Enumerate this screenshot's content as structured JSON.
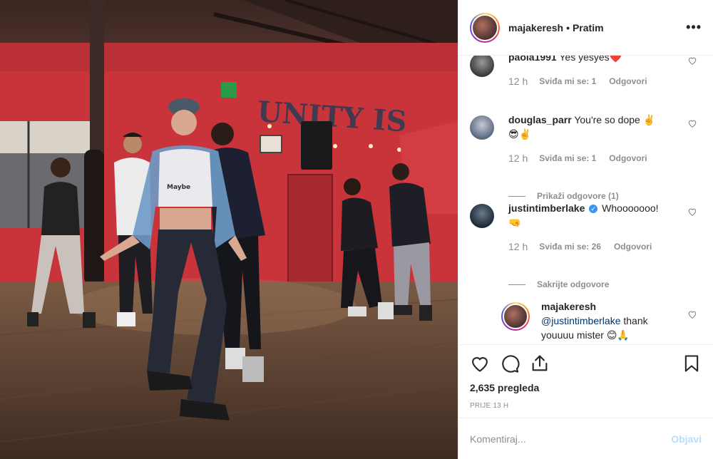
{
  "post": {
    "username": "majakeresh",
    "follow_status": "Pratim",
    "more": "•••",
    "wall_text": "UNITY IS",
    "exit_sign": "EXIT"
  },
  "comments": [
    {
      "user": "paola1991",
      "text": "Yes yesyes",
      "emoji": "❤️",
      "time": "12 h",
      "likes": "Sviđa mi se: 1",
      "reply": "Odgovori"
    },
    {
      "user": "douglas_parr",
      "text": "You're so dope ✌️",
      "emoji2": "😎✌️",
      "time": "12 h",
      "likes": "Sviđa mi se: 1",
      "reply": "Odgovori",
      "replies_toggle": "Prikaži odgovore (1)"
    },
    {
      "user": "justintimberlake",
      "verified": true,
      "text": "Whooooooo!",
      "emoji2": "🤜",
      "time": "12 h",
      "likes": "Sviđa mi se: 26",
      "reply": "Odgovori",
      "replies_toggle": "Sakrijte odgovore"
    }
  ],
  "reply": {
    "user": "majakeresh",
    "mention": "@justintimberlake",
    "text": " thank youuuu mister 😊🙏"
  },
  "stats": {
    "views": "2,635 pregleda",
    "date": "PRIJE 13 H"
  },
  "composer": {
    "placeholder": "Komentiraj...",
    "post_label": "Objavi"
  },
  "colors": {
    "wall_red": "#c8343a",
    "accent_blue": "#3897f0",
    "post_button_disabled": "#b2dffc"
  }
}
